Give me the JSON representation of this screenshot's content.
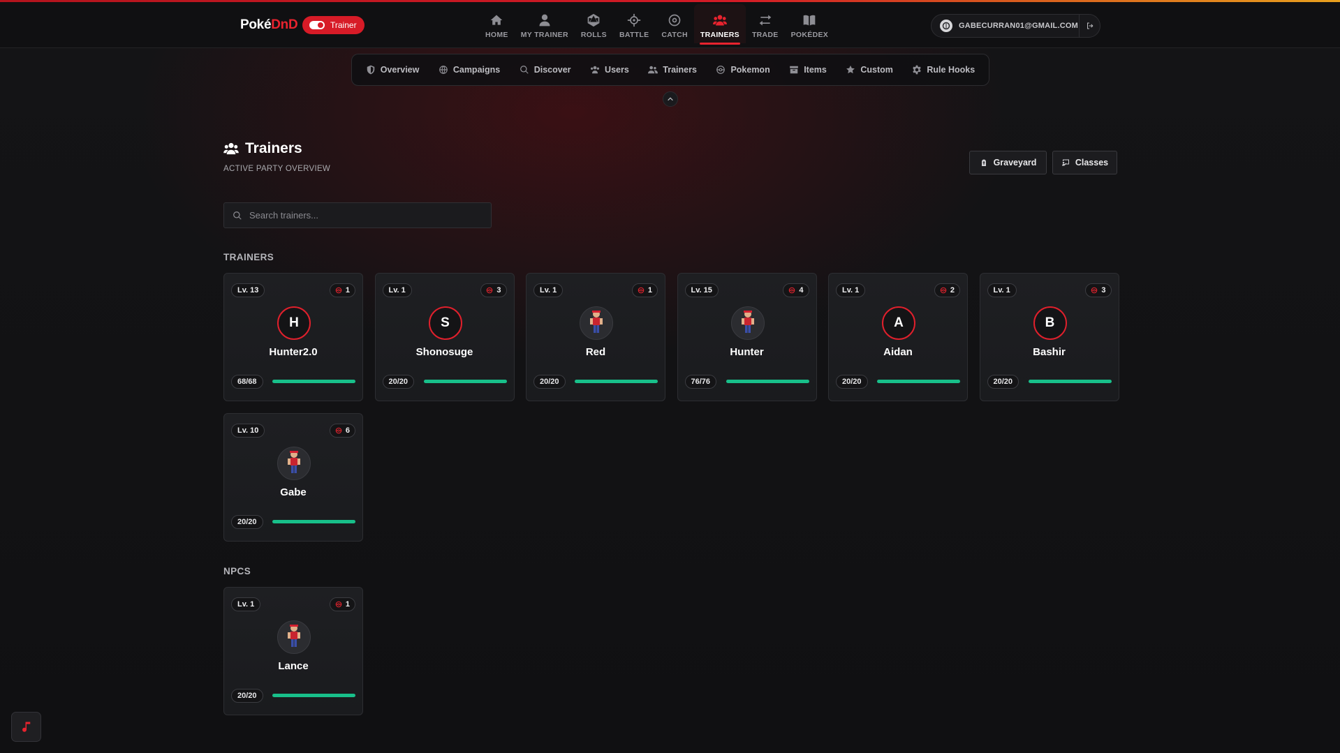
{
  "header": {
    "logo_poke": "Poké",
    "logo_dnd": "DnD",
    "mode_label": "Trainer",
    "nav": [
      {
        "label": "HOME",
        "icon": "home-icon"
      },
      {
        "label": "MY TRAINER",
        "icon": "person-icon"
      },
      {
        "label": "ROLLS",
        "icon": "dice-icon"
      },
      {
        "label": "BATTLE",
        "icon": "crosshair-icon"
      },
      {
        "label": "CATCH",
        "icon": "target-icon"
      },
      {
        "label": "TRAINERS",
        "icon": "users-icon",
        "active": true
      },
      {
        "label": "TRADE",
        "icon": "swap-icon"
      },
      {
        "label": "POKÉDEX",
        "icon": "book-icon"
      }
    ],
    "account_email": "GABECURRAN01@GMAIL.COM"
  },
  "subnav": [
    {
      "label": "Overview",
      "icon": "shield-icon"
    },
    {
      "label": "Campaigns",
      "icon": "globe-icon"
    },
    {
      "label": "Discover",
      "icon": "search-icon"
    },
    {
      "label": "Users",
      "icon": "users-icon"
    },
    {
      "label": "Trainers",
      "icon": "trainers-icon"
    },
    {
      "label": "Pokemon",
      "icon": "pokeball-icon"
    },
    {
      "label": "Items",
      "icon": "box-icon"
    },
    {
      "label": "Custom",
      "icon": "star-icon"
    },
    {
      "label": "Rule Hooks",
      "icon": "gear-icon"
    }
  ],
  "page": {
    "title": "Trainers",
    "subtitle": "ACTIVE PARTY OVERVIEW",
    "graveyard_label": "Graveyard",
    "classes_label": "Classes",
    "search_placeholder": "Search trainers..."
  },
  "sections": {
    "trainers_label": "TRAINERS",
    "npcs_label": "NPCS"
  },
  "trainers": [
    {
      "level": "Lv. 13",
      "pokemon": "1",
      "name": "Hunter2.0",
      "avatar": "H",
      "hp": "68/68",
      "hp_fraction": 1.0
    },
    {
      "level": "Lv. 1",
      "pokemon": "3",
      "name": "Shonosuge",
      "avatar": "S",
      "hp": "20/20",
      "hp_fraction": 1.0
    },
    {
      "level": "Lv. 1",
      "pokemon": "1",
      "name": "Red",
      "avatar": "",
      "hp": "20/20",
      "hp_fraction": 1.0
    },
    {
      "level": "Lv. 15",
      "pokemon": "4",
      "name": "Hunter",
      "avatar": "",
      "hp": "76/76",
      "hp_fraction": 1.0
    },
    {
      "level": "Lv. 1",
      "pokemon": "2",
      "name": "Aidan",
      "avatar": "A",
      "hp": "20/20",
      "hp_fraction": 1.0
    },
    {
      "level": "Lv. 1",
      "pokemon": "3",
      "name": "Bashir",
      "avatar": "B",
      "hp": "20/20",
      "hp_fraction": 1.0
    },
    {
      "level": "Lv. 10",
      "pokemon": "6",
      "name": "Gabe",
      "avatar": "",
      "hp": "20/20",
      "hp_fraction": 1.0
    }
  ],
  "npcs": [
    {
      "level": "Lv. 1",
      "pokemon": "1",
      "name": "Lance",
      "avatar": "",
      "hp": "20/20",
      "hp_fraction": 1.0
    }
  ],
  "colors": {
    "accent": "#e8232e",
    "hp_bar": "#18c08a",
    "background": "#121214"
  }
}
